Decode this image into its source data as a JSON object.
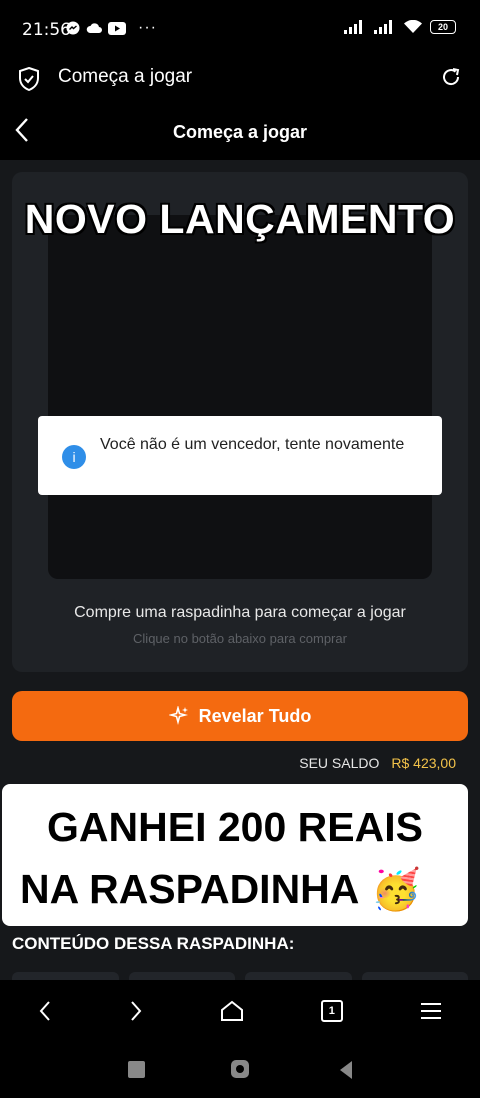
{
  "status": {
    "time": "21:56",
    "battery": "20"
  },
  "browser": {
    "title": "Começa a jogar"
  },
  "page": {
    "title": "Começa a jogar"
  },
  "overlay_banner_top": "NOVO LANÇAMENTO",
  "toast": {
    "message": "Você não é um vencedor, tente novamente"
  },
  "card": {
    "buy_text": "Compre uma raspadinha para começar a jogar",
    "buy_sub": "Clique no botão abaixo para comprar"
  },
  "reveal_button": {
    "label": "Revelar Tudo"
  },
  "balance": {
    "label": "SEU SALDO",
    "value": "R$ 423,00"
  },
  "overlay_banner_bottom": {
    "line1": "GANHEI 200 REAIS",
    "line2": "NA RASPADINHA",
    "emoji": "🥳"
  },
  "section": {
    "title": "CONTEÚDO DESSA RASPADINHA:"
  },
  "bottom_nav": {
    "tab_count": "1"
  },
  "colors": {
    "accent": "#f46a10",
    "balance": "#f2c24a",
    "info": "#2f8ee8"
  }
}
